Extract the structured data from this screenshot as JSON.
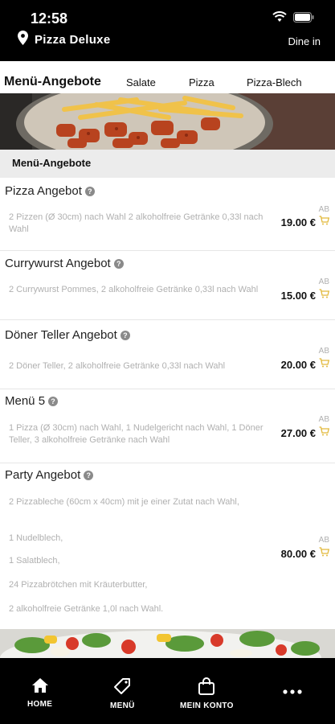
{
  "status": {
    "time": "12:58"
  },
  "header": {
    "restaurant": "Pizza Deluxe",
    "dine_in": "Dine in"
  },
  "categories": {
    "active": "Menü-Angebote",
    "tabs": [
      "Salate",
      "Pizza",
      "Pizza-Blech"
    ]
  },
  "section": {
    "title": "Menü-Angebote"
  },
  "items": [
    {
      "name": "Pizza Angebot",
      "desc": "2 Pizzen (Ø 30cm) nach Wahl 2 alkoholfreie Getränke 0,33l nach Wahl",
      "tag": "AB",
      "price": "19.00 €"
    },
    {
      "name": "Currywurst Angebot",
      "desc": "2 Currywurst Pommes, 2 alkoholfreie Getränke 0,33l nach Wahl",
      "tag": "AB",
      "price": "15.00 €"
    },
    {
      "name": "Döner Teller Angebot",
      "desc": "2 Döner Teller, 2 alkoholfreie Getränke 0,33l nach Wahl",
      "tag": "AB",
      "price": "20.00 €"
    },
    {
      "name": "Menü 5",
      "desc": "1 Pizza (Ø 30cm) nach Wahl, 1 Nudelgericht nach Wahl, 1 Döner Teller, 3 alkoholfreie Getränke nach Wahl",
      "tag": "AB",
      "price": "27.00 €"
    },
    {
      "name": "Party Angebot",
      "desc_lines": [
        "2 Pizzableche (60cm x 40cm) mit je einer Zutat nach Wahl,",
        "1 Nudelblech,",
        "1 Salatblech,",
        "24 Pizzabrötchen mit Kräuterbutter,",
        "2 alkoholfreie Getränke 1,0l nach Wahl."
      ],
      "tag": "AB",
      "price": "80.00 €"
    }
  ],
  "tabbar": [
    {
      "label": "HOME",
      "icon": "home-icon"
    },
    {
      "label": "MENÜ",
      "icon": "tag-icon"
    },
    {
      "label": "MEIN KONTO",
      "icon": "shopping-bag-icon"
    },
    {
      "label": "",
      "icon": "more-icon"
    }
  ],
  "colors": {
    "cart_accent": "#e2b93b",
    "bar_bg": "#000000",
    "section_bg": "#ececec"
  }
}
